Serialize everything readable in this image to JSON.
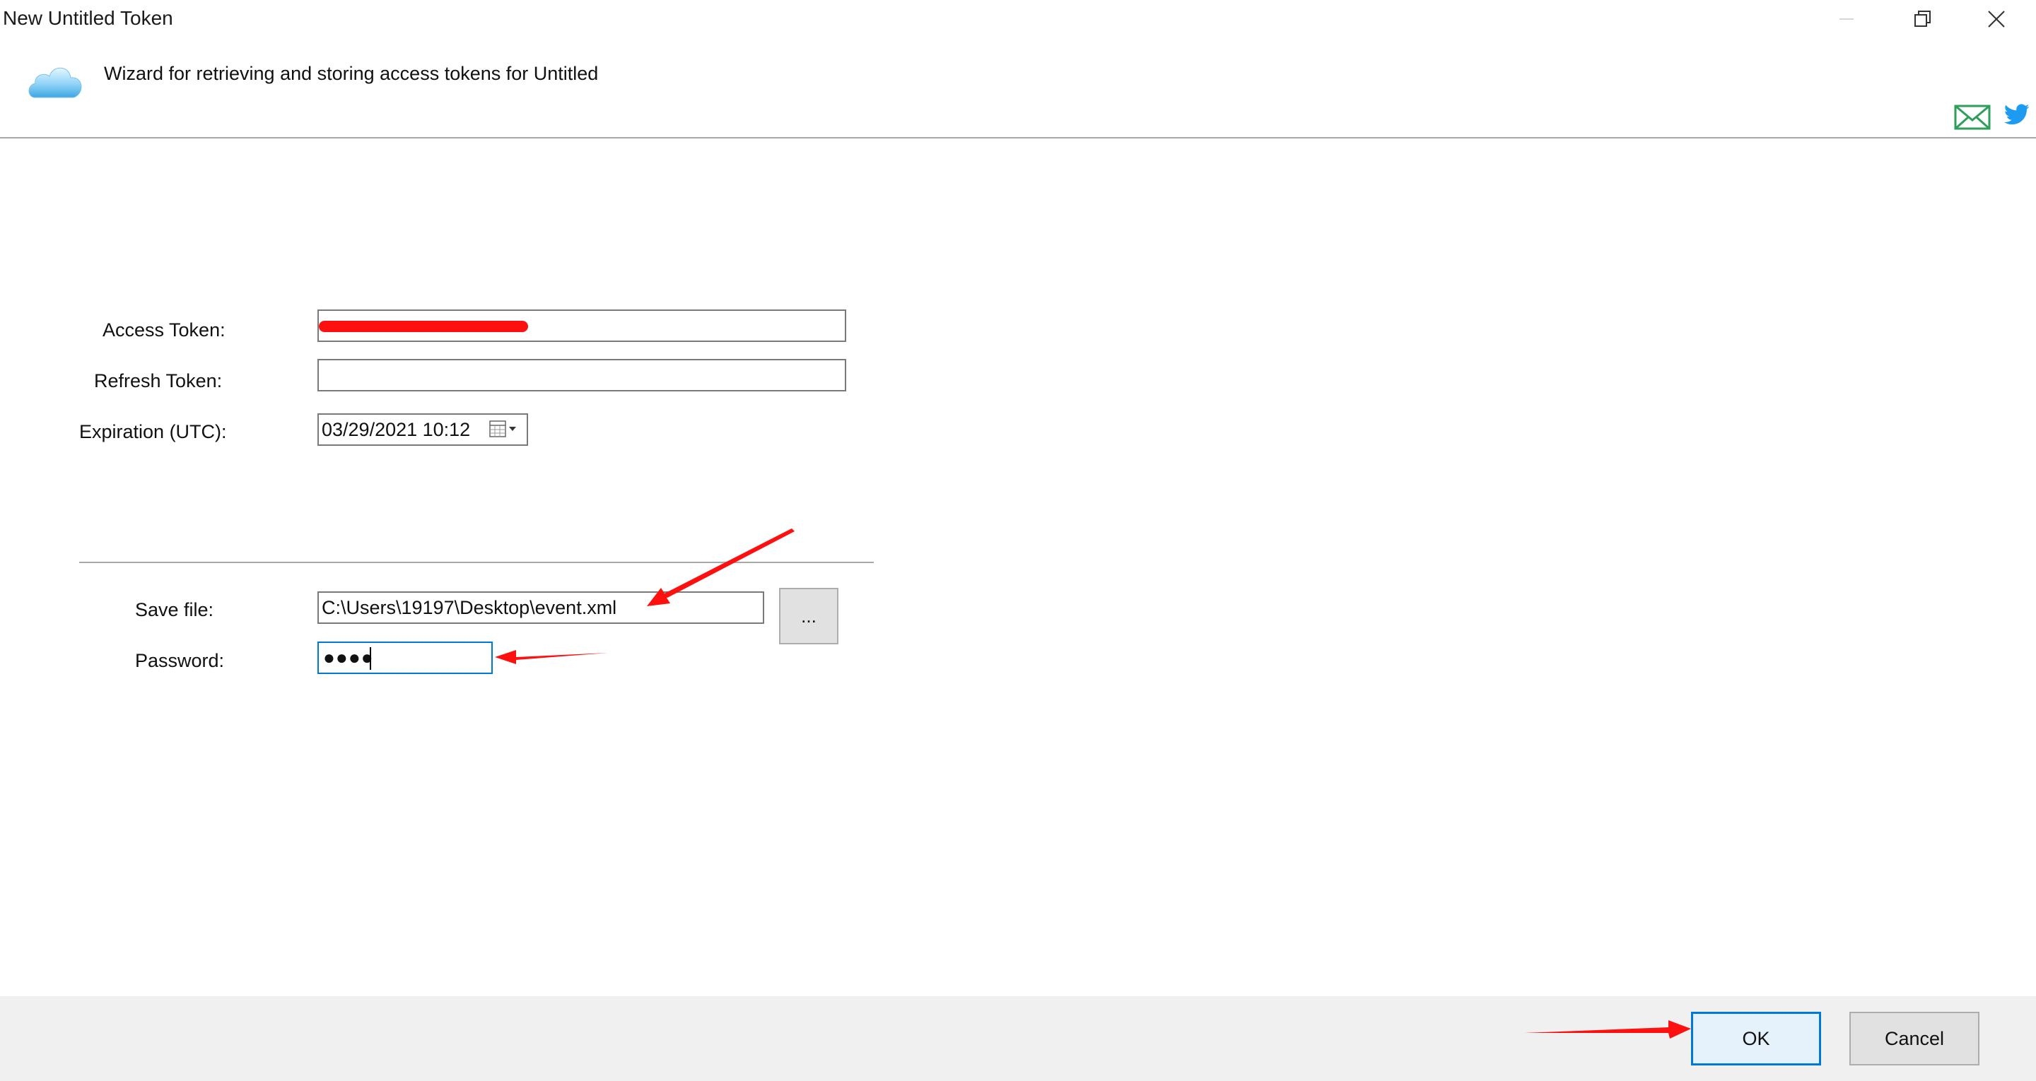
{
  "window": {
    "title": "New Untitled Token"
  },
  "header": {
    "description": "Wizard for retrieving and storing access tokens for Untitled"
  },
  "form": {
    "access_token_label": "Access Token:",
    "refresh_token_label": "Refresh Token:",
    "expiration_label": "Expiration (UTC):",
    "expiration_value": "03/29/2021 10:12",
    "save_file_label": "Save file:",
    "save_file_value": "C:\\Users\\19197\\Desktop\\event.xml",
    "browse_label": "...",
    "password_label": "Password:",
    "password_value": "●●●●",
    "refresh_token_value": ""
  },
  "footer": {
    "ok_label": "OK",
    "cancel_label": "Cancel"
  },
  "colors": {
    "accent": "#0078d7",
    "annotation": "#ff1010",
    "footer_bg": "#f0f0f0"
  },
  "icons": {
    "app": "cloud-icon",
    "email": "mail-icon",
    "social": "twitter-icon",
    "date_picker": "calendar-icon"
  }
}
